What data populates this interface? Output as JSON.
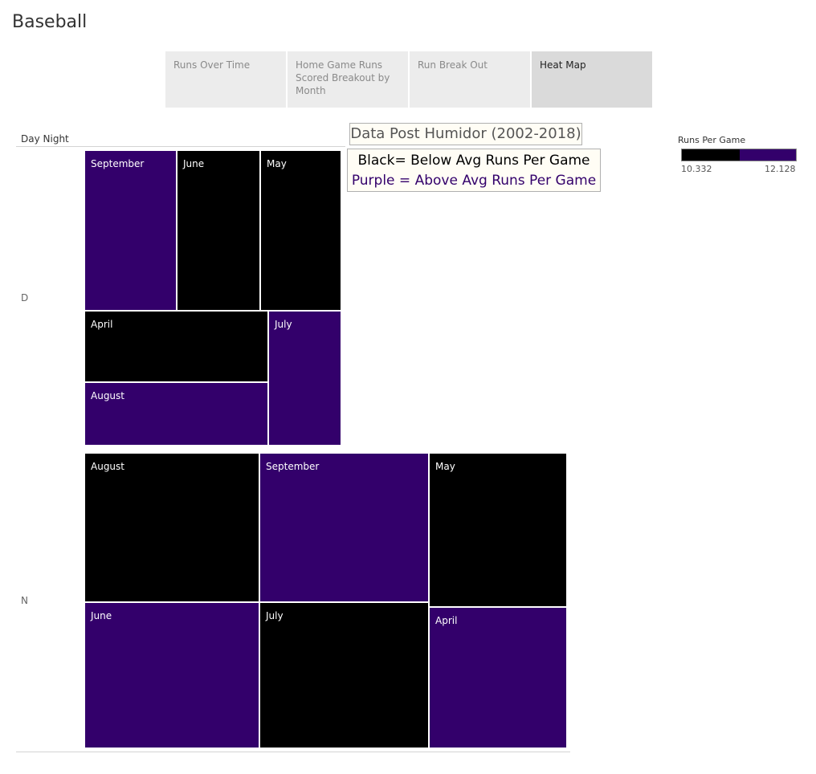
{
  "page": {
    "title": "Baseball"
  },
  "tabs": [
    {
      "label": "Runs Over Time",
      "active": false
    },
    {
      "label": "Home Game Runs Scored Breakout by Month",
      "active": false
    },
    {
      "label": "Run Break Out",
      "active": false
    },
    {
      "label": "Heat Map",
      "active": true
    }
  ],
  "colors": {
    "below_avg": "#000000",
    "above_avg": "#33006b"
  },
  "annotations": {
    "title": "Data Post Humidor (2002-2018)",
    "black_line": "Black= Below Avg Runs Per Game",
    "purple_line": "Purple = Above Avg Runs Per Game"
  },
  "legend": {
    "title": "Runs Per Game",
    "min": "10.332",
    "max": "12.128"
  },
  "chart_data": {
    "type": "heatmap",
    "header": "Day Night",
    "groups": [
      {
        "label": "D",
        "cells": [
          {
            "month": "September",
            "category": "above"
          },
          {
            "month": "June",
            "category": "below"
          },
          {
            "month": "May",
            "category": "below"
          },
          {
            "month": "April",
            "category": "below"
          },
          {
            "month": "August",
            "category": "above"
          },
          {
            "month": "July",
            "category": "above"
          }
        ]
      },
      {
        "label": "N",
        "cells": [
          {
            "month": "August",
            "category": "below"
          },
          {
            "month": "September",
            "category": "above"
          },
          {
            "month": "May",
            "category": "below"
          },
          {
            "month": "June",
            "category": "above"
          },
          {
            "month": "July",
            "category": "below"
          },
          {
            "month": "April",
            "category": "above"
          }
        ]
      }
    ]
  }
}
